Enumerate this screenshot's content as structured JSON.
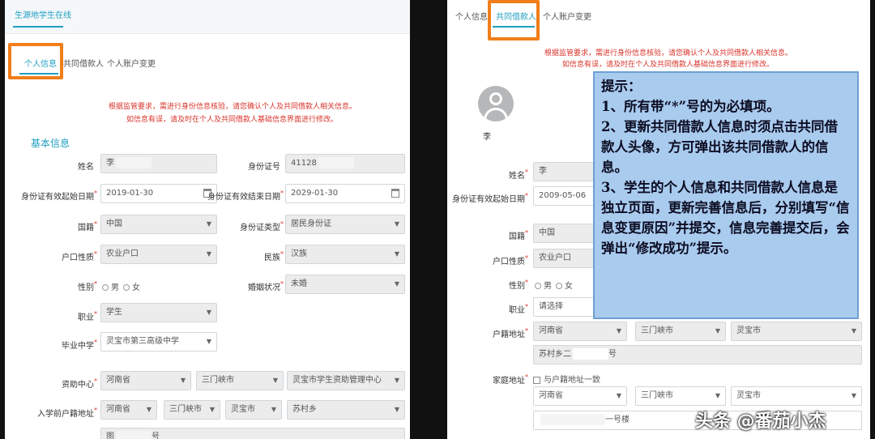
{
  "left": {
    "top_title": "生源地学生在线",
    "tabs": [
      "个人信息",
      "共同借款人",
      "个人账户变更"
    ],
    "warning": [
      "根据监管要求，需进行身份信息核验，请您确认个人及共同借款人相关信息。",
      "如信息有误，请及时在个人及共同借款人基础信息界面进行修改。"
    ],
    "section_title": "基本信息",
    "fields": {
      "name_label": "姓名",
      "name_value": "李",
      "idno_label": "身份证号",
      "idno_value": "41128",
      "id_start_label": "身份证有效起始日期",
      "id_start_value": "2019-01-30",
      "id_end_label": "身份证有效结束日期",
      "id_end_value": "2029-01-30",
      "nationality_label": "国籍",
      "nationality_value": "中国",
      "id_type_label": "身份证类型",
      "id_type_value": "居民身份证",
      "hukou_label": "户口性质",
      "hukou_value": "农业户口",
      "ethnic_label": "民族",
      "ethnic_value": "汉族",
      "gender_label": "性别",
      "gender_male": "男",
      "gender_female": "女",
      "marital_label": "婚姻状况",
      "marital_value": "未婚",
      "job_label": "职业",
      "job_value": "学生",
      "school_label": "毕业中学",
      "school_value": "灵宝市第三高级中学",
      "aid_label": "资助中心",
      "aid_province": "河南省",
      "aid_city": "三门峡市",
      "aid_center": "灵宝市学生资助管理中心",
      "pre_hukou_label": "入学前户籍地址",
      "pre_province": "河南省",
      "pre_city": "三门峡市",
      "pre_county": "灵宝市",
      "pre_town": "苏村乡",
      "pre_detail_a": "图",
      "pre_detail_b": "号"
    }
  },
  "right": {
    "tabs": [
      "个人信息",
      "共同借款人",
      "个人账户变更"
    ],
    "warning": [
      "根据监管要求，需进行身份信息核验，请您确认个人及共同借款人相关信息。",
      "如信息有误，请及时在个人及共同借款人基础信息界面进行修改。"
    ],
    "avatar_name": "李",
    "fields": {
      "name_label": "姓名",
      "name_value": "李",
      "id_start_label": "身份证有效起始日期",
      "id_start_value": "2009-05-06",
      "nationality_label": "国籍",
      "nationality_value": "中国",
      "hukou_label": "户口性质",
      "hukou_value": "农业户口",
      "gender_label": "性别",
      "gender_male": "男",
      "gender_female": "女",
      "job_label": "职业",
      "job_value": "请选择",
      "hukou_addr_label": "户籍地址",
      "hukou_province": "河南省",
      "hukou_city": "三门峡市",
      "hukou_county": "灵宝市",
      "hukou_detail_a": "苏村乡二",
      "hukou_detail_b": "号",
      "home_addr_label": "家庭地址",
      "same_as_hukou": "与户籍地址一致",
      "home_province": "河南省",
      "home_city": "三门峡市",
      "home_county": "灵宝市",
      "home_detail": "一号楼"
    },
    "tip": {
      "title": "提示：",
      "line1": "1、所有带“*”号的为必填项。",
      "line2": "2、更新共同借款人信息时须点击共同借款人头像，方可弹出该共同借款人的信息。",
      "line3": "3、学生的个人信息和共同借款人信息是独立页面，更新完善信息后，分别填写“信息变更原因”并提交，信息完善提交后，会弹出“修改成功”提示。"
    }
  },
  "watermark": "头条 @番茄小杰",
  "colors": {
    "accent": "#1f9ec1",
    "highlight": "#f07e1a",
    "warning": "#d9342b",
    "tip_bg": "#a9cbee"
  }
}
